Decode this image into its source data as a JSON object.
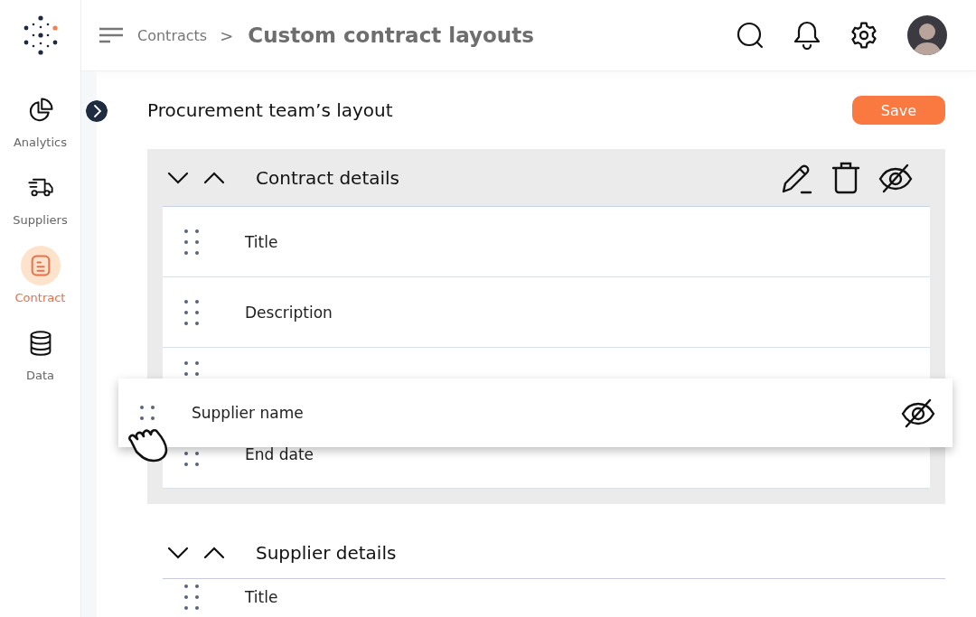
{
  "sidebar": {
    "items": [
      {
        "label": "Analytics",
        "selected": false
      },
      {
        "label": "Suppliers",
        "selected": false
      },
      {
        "label": "Contract",
        "selected": true
      },
      {
        "label": "Data",
        "selected": false
      }
    ]
  },
  "header": {
    "breadcrumb": "Contracts",
    "separator": ">",
    "title": "Custom contract layouts"
  },
  "page": {
    "title": "Procurement team’s layout",
    "save_button": "Save"
  },
  "sections": [
    {
      "title": "Contract details",
      "show_actions": true,
      "highlighted": true,
      "fields": [
        {
          "kind": "field",
          "label": "Title"
        },
        {
          "kind": "field",
          "label": "Description"
        },
        {
          "kind": "covered"
        },
        {
          "kind": "under_drag",
          "label": "End date"
        }
      ]
    },
    {
      "title": "Supplier details",
      "show_actions": false,
      "highlighted": false,
      "fields": [
        {
          "kind": "field",
          "label": "Title"
        }
      ]
    }
  ],
  "dragged_field": {
    "label": "Supplier name",
    "hidden": true
  }
}
